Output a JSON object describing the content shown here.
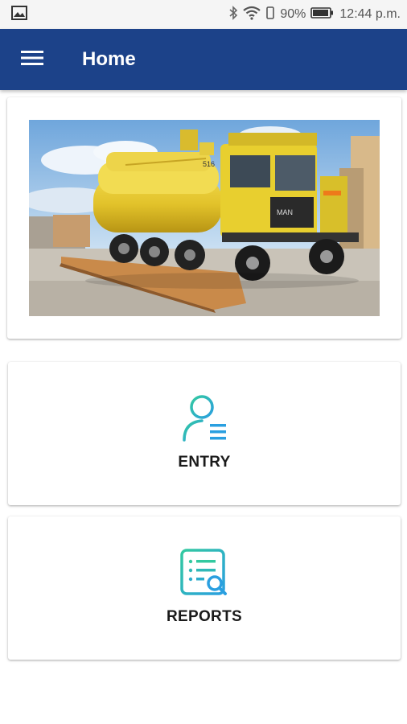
{
  "status_bar": {
    "battery_percent": "90%",
    "time": "12:44 p.m.",
    "icons": [
      "image-notification-icon",
      "bluetooth-icon",
      "wifi-icon",
      "vibrate-icon",
      "battery-icon"
    ]
  },
  "app_bar": {
    "title": "Home",
    "menu_icon": "hamburger-menu-icon",
    "background_color": "#1c4289"
  },
  "hero": {
    "image_subject": "yellow tanker truck on weighbridge",
    "truck_number": "516",
    "truck_brand": "MAN"
  },
  "tiles": {
    "entry": {
      "label": "ENTRY",
      "icon": "user-list-icon"
    },
    "reports": {
      "label": "REPORTS",
      "icon": "report-search-icon"
    }
  },
  "colors": {
    "icon_gradient_start": "#33c9a0",
    "icon_gradient_end": "#2a9fe0"
  }
}
